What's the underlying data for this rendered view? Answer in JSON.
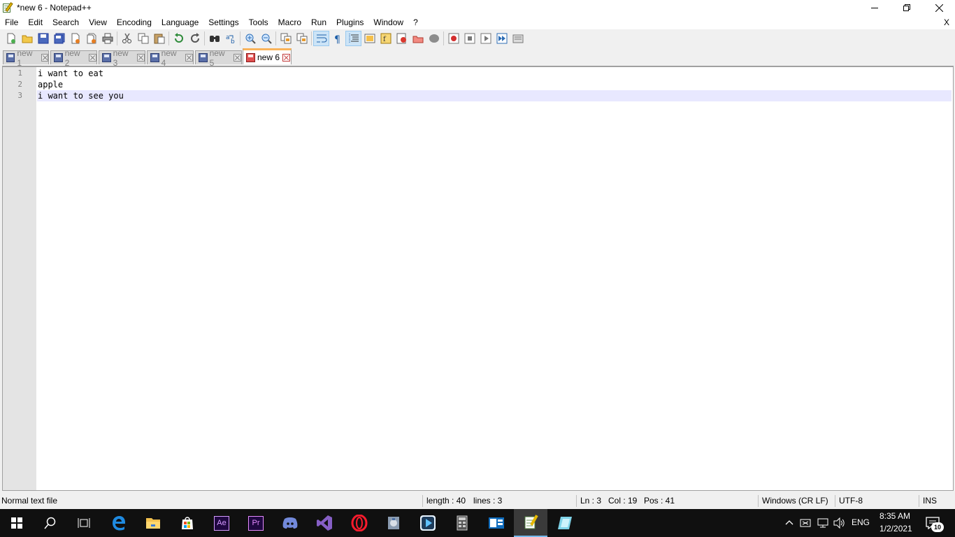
{
  "window": {
    "title": "*new 6 - Notepad++"
  },
  "menu": {
    "items": [
      "File",
      "Edit",
      "Search",
      "View",
      "Encoding",
      "Language",
      "Settings",
      "Tools",
      "Macro",
      "Run",
      "Plugins",
      "Window",
      "?"
    ],
    "close_label": "X"
  },
  "toolbar": {
    "buttons": [
      "new-file-icon",
      "open-file-icon",
      "save-icon",
      "save-all-icon",
      "close-icon",
      "close-all-icon",
      "print-icon",
      "cut-icon",
      "copy-icon",
      "paste-icon",
      "undo-icon",
      "redo-icon",
      "find-icon",
      "replace-icon",
      "zoom-in-icon",
      "zoom-out-icon",
      "sync-vertical-icon",
      "sync-horizontal-icon",
      "word-wrap-icon",
      "show-all-characters-icon",
      "indent-guide-icon",
      "document-map-icon",
      "function-list-icon",
      "folder-workspace-icon",
      "doc-list-icon",
      "monitoring-icon",
      "record-macro-icon",
      "stop-recording-icon",
      "playback-macro-icon",
      "run-macro-multiple-icon",
      "save-macro-icon"
    ]
  },
  "tabs": [
    {
      "label": "new 1",
      "active": false
    },
    {
      "label": "new 2",
      "active": false
    },
    {
      "label": "new 3",
      "active": false
    },
    {
      "label": "new 4",
      "active": false
    },
    {
      "label": "new 5",
      "active": false
    },
    {
      "label": "new 6",
      "active": true
    }
  ],
  "editor": {
    "line_numbers": [
      "1",
      "2",
      "3"
    ],
    "lines": [
      "i want to eat",
      "apple",
      "i want to see you"
    ],
    "current_line": 3
  },
  "statusbar": {
    "file_type": "Normal text file",
    "length": "length : 40",
    "lines": "lines : 3",
    "ln": "Ln : 3",
    "col": "Col : 19",
    "pos": "Pos : 41",
    "eol": "Windows (CR LF)",
    "encoding": "UTF-8",
    "mode": "INS"
  },
  "taskbar": {
    "apps": [
      "start-icon",
      "search-icon",
      "task-view-icon",
      "edge-icon",
      "file-explorer-icon",
      "store-icon",
      "after-effects-icon",
      "premiere-icon",
      "discord-icon",
      "visual-studio-icon",
      "opera-icon",
      "app-icon",
      "media-player-icon",
      "calculator-icon",
      "outlook-icon",
      "notepad-plus-plus-icon",
      "app-icon-2"
    ],
    "ae_label": "Ae",
    "pr_label": "Pr",
    "language": "ENG",
    "time": "8:35 AM",
    "date": "1/2/2021",
    "notification_count": "10"
  },
  "colors": {
    "active_tab_accent": "#fab45a",
    "current_line": "#e8e8ff",
    "gutter": "#e4e4e4",
    "taskbar": "#101010"
  }
}
